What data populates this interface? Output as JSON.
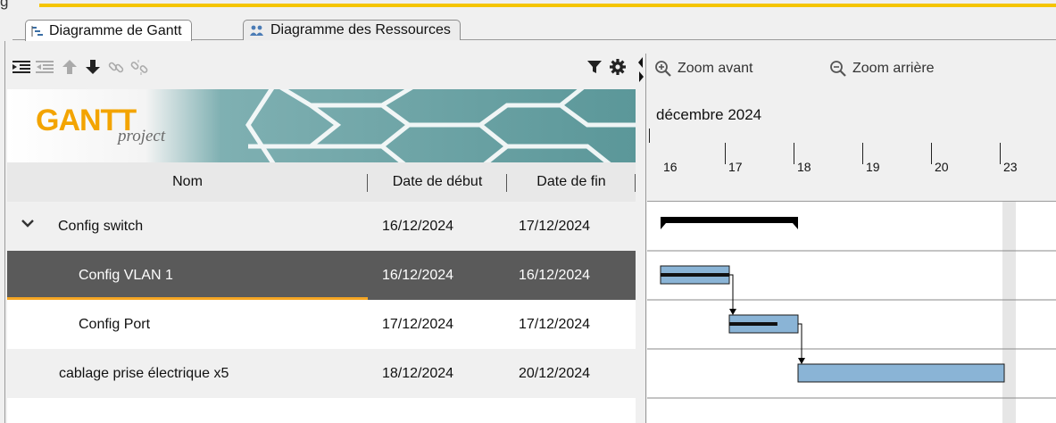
{
  "tabs": [
    {
      "label": "Diagramme de Gantt",
      "active": true,
      "icon": "gantt-tab-icon"
    },
    {
      "label": "Diagramme des Ressources",
      "active": false,
      "icon": "resources-tab-icon"
    }
  ],
  "left_toolbar": {
    "icons": [
      "indent-icon",
      "outdent-icon",
      "move-up-icon",
      "move-down-icon",
      "link-icon",
      "unlink-icon"
    ],
    "right_icons": [
      "filter-icon",
      "settings-icon"
    ]
  },
  "logo": {
    "word": "GANTT",
    "sub": "project"
  },
  "table": {
    "columns": [
      "Nom",
      "Date de début",
      "Date de fin"
    ],
    "rows": [
      {
        "name": "Config switch",
        "start": "16/12/2024",
        "end": "17/12/2024",
        "level": 0,
        "expanded": true,
        "selected": false
      },
      {
        "name": "Config VLAN 1",
        "start": "16/12/2024",
        "end": "16/12/2024",
        "level": 1,
        "selected": true
      },
      {
        "name": "Config Port",
        "start": "17/12/2024",
        "end": "17/12/2024",
        "level": 1,
        "selected": false
      },
      {
        "name": "cablage prise électrique x5",
        "start": "18/12/2024",
        "end": "20/12/2024",
        "level": 0,
        "selected": false
      }
    ]
  },
  "chart_toolbar": {
    "zoom_in": "Zoom avant",
    "zoom_out": "Zoom arrière"
  },
  "timeline": {
    "month": "décembre 2024",
    "days": [
      "16",
      "17",
      "18",
      "19",
      "20",
      "23"
    ]
  },
  "gantt": {
    "summary": {
      "name": "Config switch",
      "start": "2024-12-16",
      "end": "2024-12-17"
    },
    "tasks": [
      {
        "name": "Config VLAN 1",
        "start": "2024-12-16",
        "end": "2024-12-16",
        "progress": 1.0
      },
      {
        "name": "Config Port",
        "start": "2024-12-17",
        "end": "2024-12-17",
        "progress": 0.7
      },
      {
        "name": "cablage prise électrique x5",
        "start": "2024-12-18",
        "end": "2024-12-20",
        "progress": 0
      }
    ],
    "dependencies": [
      {
        "from": "Config VLAN 1",
        "to": "Config Port"
      },
      {
        "from": "Config Port",
        "to": "cablage prise électrique x5"
      }
    ]
  },
  "colors": {
    "accent": "#f5c500",
    "selection": "#5a5a5a",
    "selection_underline": "#f5a623",
    "task_bar": "#8ab4d6",
    "logo_teal": "#5f9ea0",
    "logo_orange": "#f3a400"
  }
}
